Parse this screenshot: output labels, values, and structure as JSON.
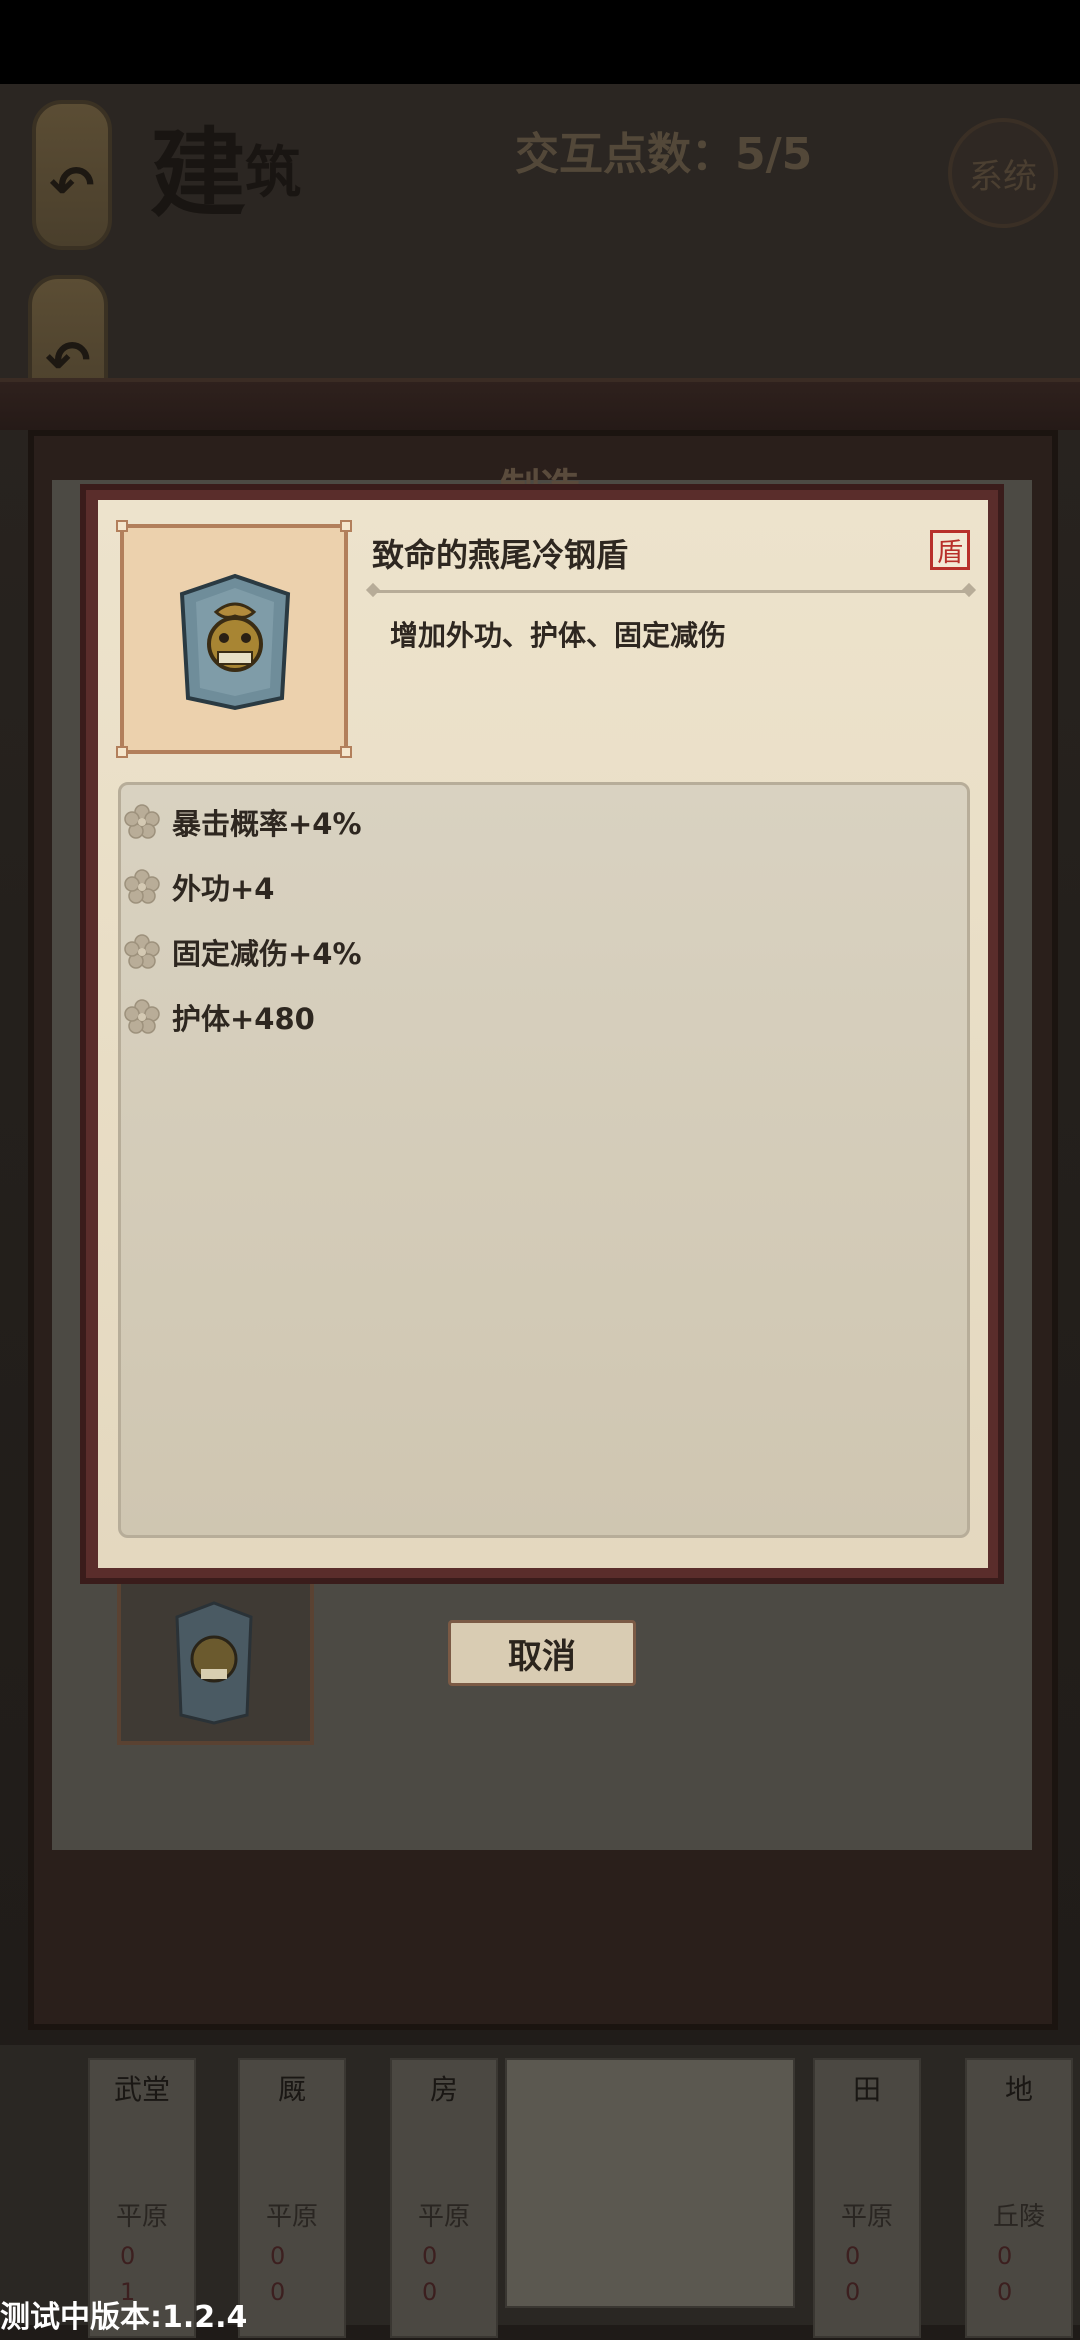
{
  "header": {
    "title_main": "建",
    "title_sub": "筑",
    "interaction_points": "交互点数：5/5",
    "system_label": "系统",
    "back_icon": "undo-arrow-icon"
  },
  "panel": {
    "make_label": "制造"
  },
  "modal": {
    "item_name": "致命的燕尾冷钢盾",
    "type_badge": "盾",
    "description": "增加外功、护体、固定减伤",
    "stats": [
      {
        "icon": "flower-icon",
        "label": "暴击概率+4%"
      },
      {
        "icon": "flower-icon",
        "label": "外功+4"
      },
      {
        "icon": "flower-icon",
        "label": "固定减伤+4%"
      },
      {
        "icon": "flower-icon",
        "label": "护体+480"
      }
    ]
  },
  "actions": {
    "cancel_label": "取消"
  },
  "buildings": [
    {
      "name": "武堂",
      "terrain": "平原",
      "stat1": "0",
      "stat2": "1"
    },
    {
      "name": "厩",
      "terrain": "平原",
      "stat1": "0",
      "stat2": "0"
    },
    {
      "name": "房",
      "terrain": "平原",
      "stat1": "0",
      "stat2": "0"
    },
    {
      "name": "田",
      "terrain": "平原",
      "stat1": "0",
      "stat2": "0"
    },
    {
      "name": "地",
      "terrain": "丘陵",
      "stat1": "0",
      "stat2": "0"
    }
  ],
  "footer": {
    "version": "测试中版本:1.2.4"
  },
  "colors": {
    "modal_border": "#5a2d2b",
    "badge_red": "#b8302a",
    "parchment": "#ede3cc"
  }
}
